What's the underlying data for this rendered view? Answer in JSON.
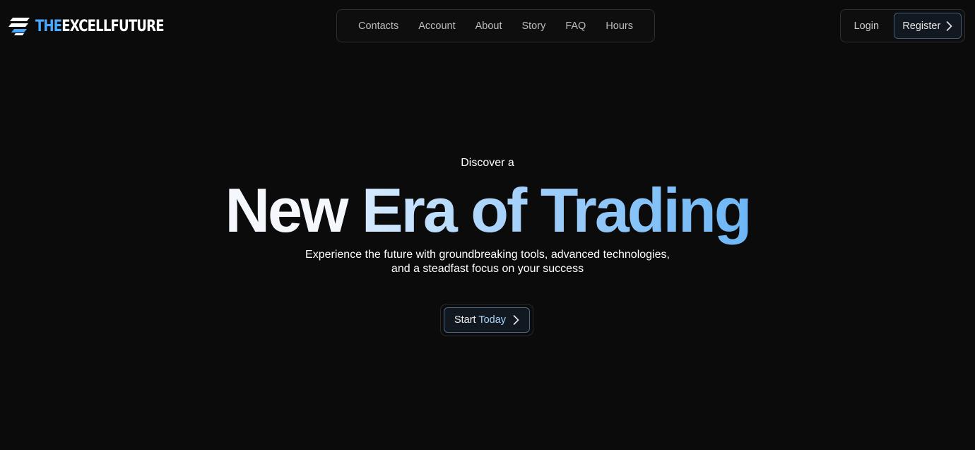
{
  "brand": {
    "prefix": "THE",
    "name": "EXCELLFUTURE",
    "accent_color": "#4aa8ff"
  },
  "nav": {
    "items": [
      {
        "label": "Contacts"
      },
      {
        "label": "Account"
      },
      {
        "label": "About"
      },
      {
        "label": "Story"
      },
      {
        "label": "FAQ"
      },
      {
        "label": "Hours"
      }
    ]
  },
  "auth": {
    "login_label": "Login",
    "register_label": "Register",
    "register_icon": "chevron-right-icon"
  },
  "hero": {
    "kicker": "Discover a",
    "title_part1": "New",
    "title_part2": "Era of Trading",
    "subtitle_line1": "Experience the future with groundbreaking tools, advanced technologies,",
    "subtitle_line2": "and a steadfast focus on your success",
    "cta_part1": "Start",
    "cta_part2": "Today",
    "cta_icon": "chevron-right-icon"
  },
  "colors": {
    "background": "#0b0b0b",
    "gradient_end": "#6db6f5"
  }
}
